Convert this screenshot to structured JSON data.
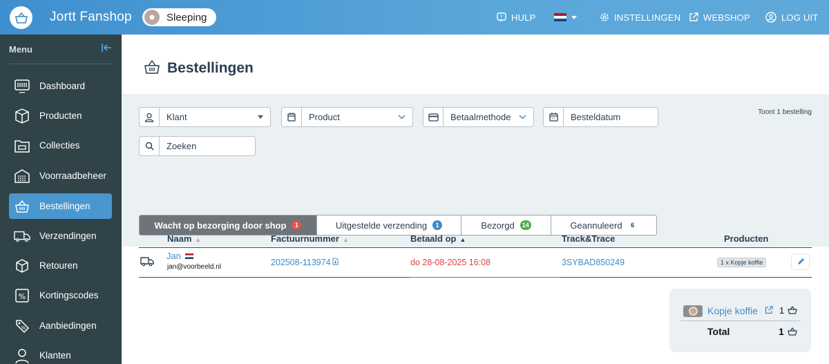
{
  "topbar": {
    "app_title": "Jortt Fanshop",
    "status": "Sleeping",
    "nav": {
      "help": "HULP",
      "settings": "INSTELLINGEN",
      "webshop": "WEBSHOP",
      "logout": "LOG UIT"
    },
    "language_flag": "flag-nl-icon"
  },
  "sidebar": {
    "heading": "Menu",
    "items": [
      {
        "label": "Dashboard",
        "icon": "dashboard-icon"
      },
      {
        "label": "Producten",
        "icon": "box-icon"
      },
      {
        "label": "Collecties",
        "icon": "folder-icon"
      },
      {
        "label": "Voorraadbeheer",
        "icon": "warehouse-icon"
      },
      {
        "label": "Bestellingen",
        "icon": "basket-icon",
        "active": true
      },
      {
        "label": "Verzendingen",
        "icon": "truck-icon"
      },
      {
        "label": "Retouren",
        "icon": "return-box-icon"
      },
      {
        "label": "Kortingscodes",
        "icon": "percent-icon"
      },
      {
        "label": "Aanbiedingen",
        "icon": "tag-icon"
      },
      {
        "label": "Klanten",
        "icon": "user-icon"
      }
    ]
  },
  "page": {
    "title": "Bestellingen",
    "count_text": "Toont 1 bestelling"
  },
  "filters": {
    "customer": "Klant",
    "product": "Product",
    "payment_method": "Betaalmethode",
    "order_date_placeholder": "Besteldatum",
    "search_placeholder": "Zoeken"
  },
  "tabs": [
    {
      "label": "Wacht op bezorging door shop",
      "count": "1",
      "badge_color": "#e0534b"
    },
    {
      "label": "Uitgestelde verzending",
      "count": "1",
      "badge_color": "#3e8cc8"
    },
    {
      "label": "Bezorgd",
      "count": "14",
      "badge_color": "#4cae4c"
    },
    {
      "label": "Geannuleerd",
      "count": "6",
      "badge_color": "#ffffff"
    }
  ],
  "table": {
    "headers": {
      "name": "Naam",
      "invoice": "Factuurnummer",
      "paid_on": "Betaald op",
      "track": "Track&Trace",
      "products": "Producten"
    },
    "rows": [
      {
        "name": "Jan",
        "email": "jan@voorbeeld.nl",
        "invoice": "202508-113974",
        "paid_on": "do 28-08-2025 16:08",
        "track": "3SYBAD850249",
        "products": "1 x Kopje koffie"
      }
    ]
  },
  "summary": {
    "product_name": "Kopje koffie",
    "product_qty": "1",
    "total_label": "Total",
    "total_qty": "1"
  },
  "colors": {
    "accent": "#4a97d0",
    "sidebar": "#2f4348",
    "link": "#3e8cc8",
    "danger": "#e0443e"
  }
}
